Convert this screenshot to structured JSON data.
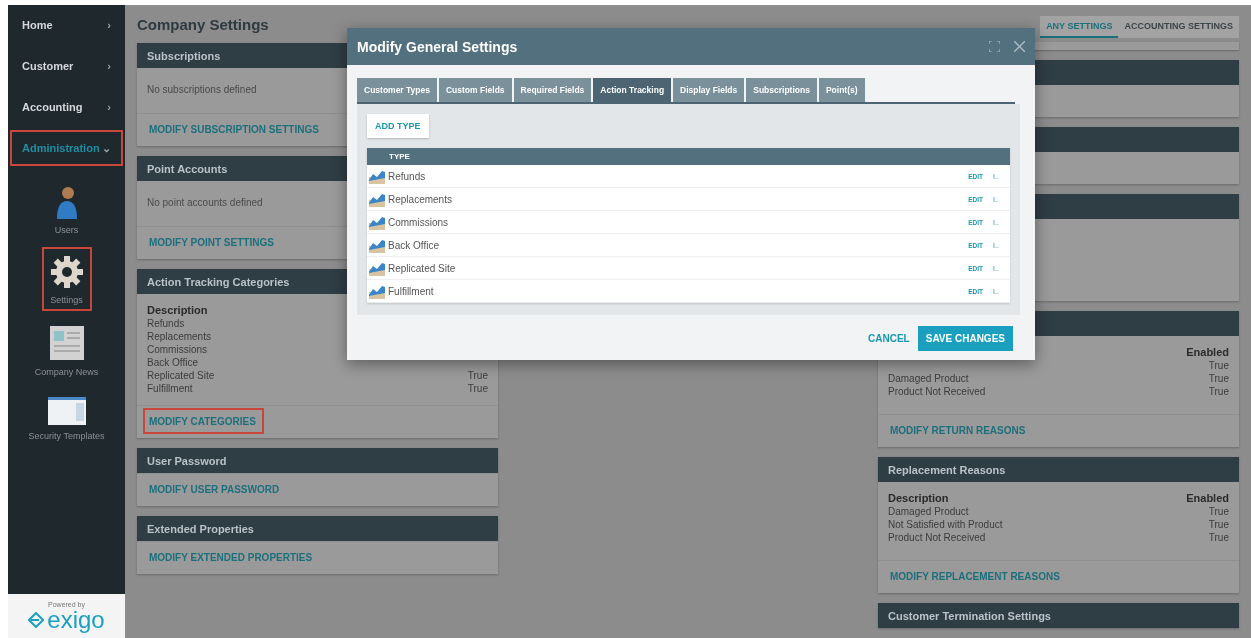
{
  "sidebar": {
    "menu": [
      {
        "label": "Home",
        "arrow": "›",
        "highlighted": false,
        "selected": false
      },
      {
        "label": "Customer",
        "arrow": "›",
        "highlighted": false,
        "selected": false
      },
      {
        "label": "Accounting",
        "arrow": "›",
        "highlighted": false,
        "selected": false
      },
      {
        "label": "Administration",
        "arrow": "⌄",
        "highlighted": true,
        "selected": true
      }
    ],
    "apps": [
      {
        "label": "Users",
        "kind": "user",
        "highlighted": false
      },
      {
        "label": "Settings",
        "kind": "gear",
        "highlighted": true
      },
      {
        "label": "Company News",
        "kind": "news",
        "highlighted": false
      },
      {
        "label": "Security Templates",
        "kind": "window",
        "highlighted": false
      }
    ],
    "powered_by": "Powered by",
    "logo": "exigo"
  },
  "page_title": "Company Settings",
  "top_tabs": [
    {
      "label": "ANY SETTINGS",
      "selected": true
    },
    {
      "label": "ACCOUNTING SETTINGS",
      "selected": false
    }
  ],
  "left_cards": [
    {
      "title": "Subscriptions",
      "text": "No subscriptions defined",
      "link": "MODIFY SUBSCRIPTION SETTINGS",
      "highlighted": false
    },
    {
      "title": "Point Accounts",
      "text": "No point accounts defined",
      "link": "MODIFY POINT SETTINGS",
      "highlighted": false
    },
    {
      "title": "Action Tracking Categories",
      "table": {
        "column_1": "Description",
        "rows": [
          {
            "description": "Refunds"
          },
          {
            "description": "Replacements"
          },
          {
            "description": "Commissions"
          },
          {
            "description": "Back Office"
          },
          {
            "description": "Replicated Site",
            "enabled": "True"
          },
          {
            "description": "Fulfillment",
            "enabled": "True"
          }
        ]
      },
      "link": "MODIFY CATEGORIES",
      "highlighted": true
    },
    {
      "title": "User Password",
      "link": "MODIFY USER PASSWORD",
      "highlighted": false
    },
    {
      "title": "Extended Properties",
      "link": "MODIFY EXTENDED PROPERTIES",
      "highlighted": false
    }
  ],
  "right_cards": [
    {
      "kind": "blank"
    },
    {
      "kind": "blank"
    },
    {
      "kind": "tall"
    },
    {
      "kind": "table",
      "table": {
        "column_2": "Enabled",
        "rows": [
          {
            "enabled": "True"
          },
          {
            "description": "Damaged Product",
            "enabled": "True"
          },
          {
            "description": "Product Not Received",
            "enabled": "True"
          }
        ]
      },
      "link": "MODIFY RETURN REASONS"
    },
    {
      "kind": "table",
      "title": "Replacement Reasons",
      "table": {
        "column_1": "Description",
        "column_2": "Enabled",
        "rows": [
          {
            "description": "Damaged Product",
            "enabled": "True"
          },
          {
            "description": "Not Satisfied with Product",
            "enabled": "True"
          },
          {
            "description": "Product Not Received",
            "enabled": "True"
          }
        ]
      },
      "link": "MODIFY REPLACEMENT REASONS"
    },
    {
      "kind": "header",
      "title": "Customer Termination Settings"
    }
  ],
  "dialog": {
    "title": "Modify General Settings",
    "tabs": [
      {
        "label": "Customer Types",
        "selected": false
      },
      {
        "label": "Custom Fields",
        "selected": false
      },
      {
        "label": "Required Fields",
        "selected": false
      },
      {
        "label": "Action Tracking",
        "selected": true
      },
      {
        "label": "Display Fields",
        "selected": false
      },
      {
        "label": "Subscriptions",
        "selected": false
      },
      {
        "label": "Point(s)",
        "selected": false
      }
    ],
    "add_button": "ADD TYPE",
    "table": {
      "column": "TYPE",
      "rows": [
        {
          "type": "Refunds",
          "edit": "EDIT",
          "more": "I.."
        },
        {
          "type": "Replacements",
          "edit": "EDIT",
          "more": "I.."
        },
        {
          "type": "Commissions",
          "edit": "EDIT",
          "more": "I.."
        },
        {
          "type": "Back Office",
          "edit": "EDIT",
          "more": "I.."
        },
        {
          "type": "Replicated Site",
          "edit": "EDIT",
          "more": "I.."
        },
        {
          "type": "Fulfillment",
          "edit": "EDIT",
          "more": "I.."
        }
      ]
    },
    "cancel": "CANCEL",
    "save": "SAVE CHANGES"
  }
}
